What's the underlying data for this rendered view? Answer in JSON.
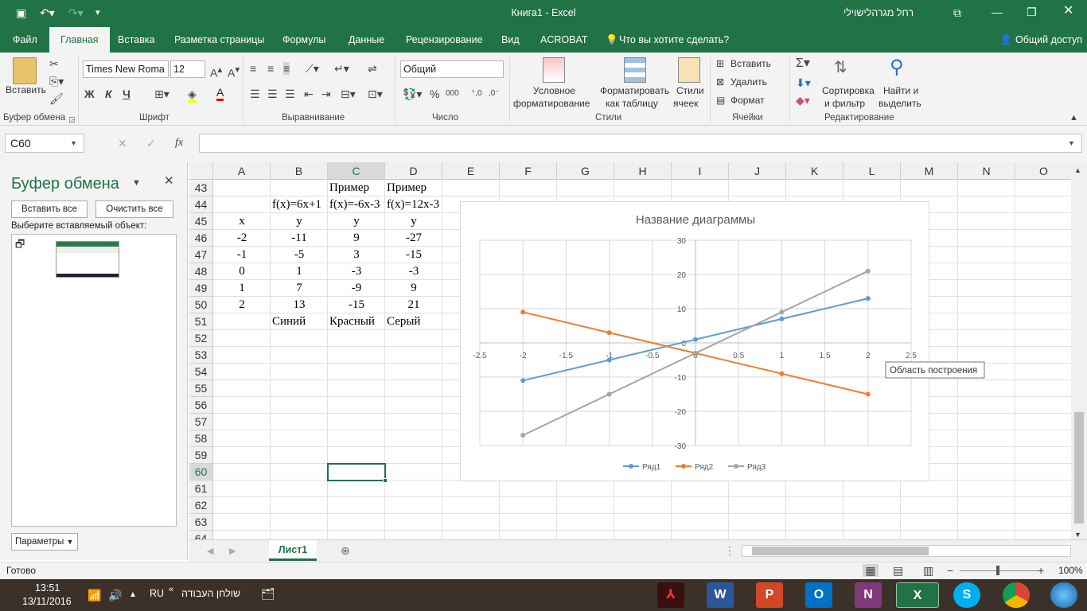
{
  "window": {
    "title": "Книга1  -  Excel",
    "user": "רחל מגרהלישוילי"
  },
  "tabs": [
    {
      "label": "Файл"
    },
    {
      "label": "Главная"
    },
    {
      "label": "Вставка"
    },
    {
      "label": "Разметка страницы"
    },
    {
      "label": "Формулы"
    },
    {
      "label": "Данные"
    },
    {
      "label": "Рецензирование"
    },
    {
      "label": "Вид"
    },
    {
      "label": "ACROBAT"
    }
  ],
  "tell_me": "Что вы хотите сделать?",
  "share": "Общий доступ",
  "ribbon": {
    "paste": "Вставить",
    "font_name": "Times New Roma",
    "font_size": "12",
    "bold": "Ж",
    "italic": "К",
    "underline": "Ч",
    "number_format": "Общий",
    "cond_format_1": "Условное",
    "cond_format_2": "форматирование",
    "as_table_1": "Форматировать",
    "as_table_2": "как таблицу",
    "cell_styles_1": "Стили",
    "cell_styles_2": "ячеек",
    "insert": "Вставить",
    "delete": "Удалить",
    "format": "Формат",
    "sort_1": "Сортировка",
    "sort_2": "и фильтр",
    "find_1": "Найти и",
    "find_2": "выделить",
    "groups": {
      "clipboard": "Буфер обмена",
      "font": "Шрифт",
      "alignment": "Выравнивание",
      "number": "Число",
      "styles": "Стили",
      "cells": "Ячейки",
      "editing": "Редактирование"
    }
  },
  "formula_bar": {
    "name_box": "C60",
    "fx": "fx",
    "formula": ""
  },
  "clipboard_pane": {
    "title": "Буфер обмена",
    "paste_all": "Вставить все",
    "clear_all": "Очистить все",
    "prompt": "Выберите вставляемый объект:",
    "options": "Параметры"
  },
  "columns": [
    "A",
    "B",
    "C",
    "D",
    "E",
    "F",
    "G",
    "H",
    "I",
    "J",
    "K",
    "L",
    "M",
    "N",
    "O"
  ],
  "rows": [
    "43",
    "44",
    "45",
    "46",
    "47",
    "48",
    "49",
    "50",
    "51",
    "52",
    "53",
    "54",
    "55",
    "56",
    "57",
    "58",
    "59",
    "60",
    "61",
    "62",
    "63",
    "64"
  ],
  "cells": {
    "C43": "Пример",
    "D43": "Пример",
    "B44": "f(x)=6x+1",
    "C44": "f(x)=-6x-3",
    "D44": "f(x)=12x-3",
    "A45": "x",
    "B45": "y",
    "C45": "y",
    "D45": "y",
    "A46": "-2",
    "B46": "-11",
    "C46": "9",
    "D46": "-27",
    "A47": "-1",
    "B47": "-5",
    "C47": "3",
    "D47": "-15",
    "A48": "0",
    "B48": "1",
    "C48": "-3",
    "D48": "-3",
    "A49": "1",
    "B49": "7",
    "C49": "-9",
    "D49": "9",
    "A50": "2",
    "B50": "13",
    "C50": "-15",
    "D50": "21",
    "B51": "Синий",
    "C51": "Красный",
    "D51": "Серый"
  },
  "chart_data": {
    "type": "scatter",
    "title": "Название диаграммы",
    "x": [
      -2,
      -1,
      0,
      1,
      2
    ],
    "xlim": [
      -2.5,
      2.5
    ],
    "ylim": [
      -30,
      30
    ],
    "xticks": [
      "-2.5",
      "-2",
      "-1.5",
      "-1",
      "-0.5",
      "0",
      "0.5",
      "1",
      "1.5",
      "2",
      "2.5"
    ],
    "yticks": [
      "30",
      "20",
      "10",
      "0",
      "-10",
      "-20",
      "-30"
    ],
    "grid": true,
    "legend_position": "bottom",
    "series": [
      {
        "name": "Ряд1",
        "color": "#5b9bd5",
        "values": [
          -11,
          -5,
          1,
          7,
          13
        ]
      },
      {
        "name": "Ряд2",
        "color": "#ed7d31",
        "values": [
          9,
          3,
          -3,
          -9,
          -15
        ]
      },
      {
        "name": "Ряд3",
        "color": "#a5a5a5",
        "values": [
          -27,
          -15,
          -3,
          9,
          21
        ]
      }
    ],
    "tooltip": "Область построения"
  },
  "sheet_tab": "Лист1",
  "status": {
    "ready": "Готово",
    "zoom": "100%"
  },
  "taskbar": {
    "time": "13:51",
    "date": "13/11/2016",
    "lang": "RU",
    "desktop": "שולחן העבודה"
  }
}
